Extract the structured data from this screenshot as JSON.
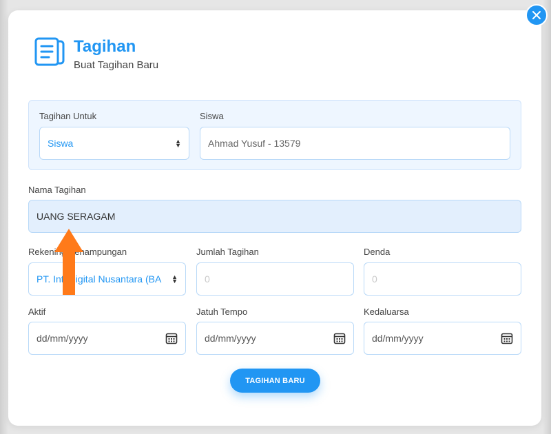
{
  "header": {
    "title": "Tagihan",
    "subtitle": "Buat Tagihan Baru",
    "icon": "document-list-icon"
  },
  "close": {
    "icon": "close-icon"
  },
  "form": {
    "tagihan_untuk": {
      "label": "Tagihan Untuk",
      "value": "Siswa"
    },
    "siswa": {
      "label": "Siswa",
      "value": "Ahmad Yusuf - 13579"
    },
    "nama_tagihan": {
      "label": "Nama Tagihan",
      "value": "UANG SERAGAM"
    },
    "rekening": {
      "label": "Rekening Penampungan",
      "value": "PT. Inti Digital Nusantara (BA"
    },
    "jumlah_tagihan": {
      "label": "Jumlah Tagihan",
      "placeholder": "0"
    },
    "denda": {
      "label": "Denda",
      "placeholder": "0"
    },
    "aktif": {
      "label": "Aktif",
      "value": "dd/mm/yyyy"
    },
    "jatuh_tempo": {
      "label": "Jatuh Tempo",
      "value": "dd/mm/yyyy"
    },
    "kedaluarsa": {
      "label": "Kedaluarsa",
      "value": "dd/mm/yyyy"
    }
  },
  "submit_label": "TAGIHAN BARU",
  "colors": {
    "accent": "#2196f3",
    "annotation_arrow": "#ff7a1a",
    "panel_bg": "#eef6ff"
  }
}
